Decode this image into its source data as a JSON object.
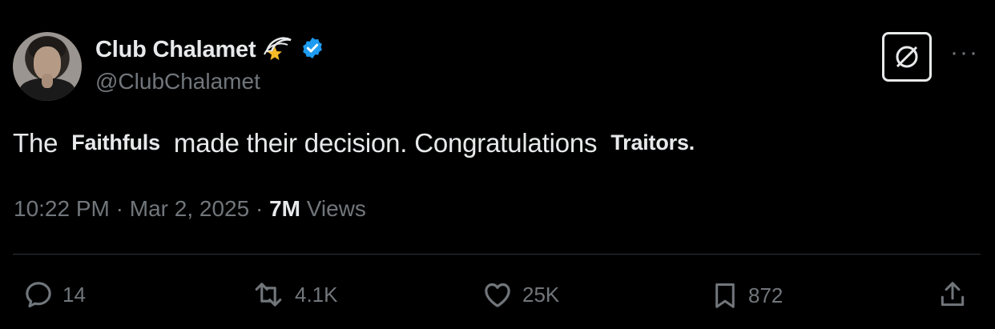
{
  "author": {
    "name": "Club Chalamet",
    "handle": "@ClubChalamet",
    "emoji_icon": "shooting-star-emoji",
    "verified": true,
    "verified_color": "#1d9bf0"
  },
  "tweet": {
    "parts": [
      "The",
      "Faithfuls",
      "made their decision.  Congratulations",
      "Traitors."
    ]
  },
  "meta": {
    "time": "10:22 PM",
    "sep1": " · ",
    "date": "Mar 2, 2025",
    "sep2": " · ",
    "views_count": "7M",
    "views_label": " Views"
  },
  "actions": {
    "replies": "14",
    "reposts": "4.1K",
    "likes": "25K",
    "bookmarks": "872"
  },
  "colors": {
    "background": "#000000",
    "text": "#e7e9ea",
    "secondary": "#71767b",
    "divider": "#2f3336"
  }
}
